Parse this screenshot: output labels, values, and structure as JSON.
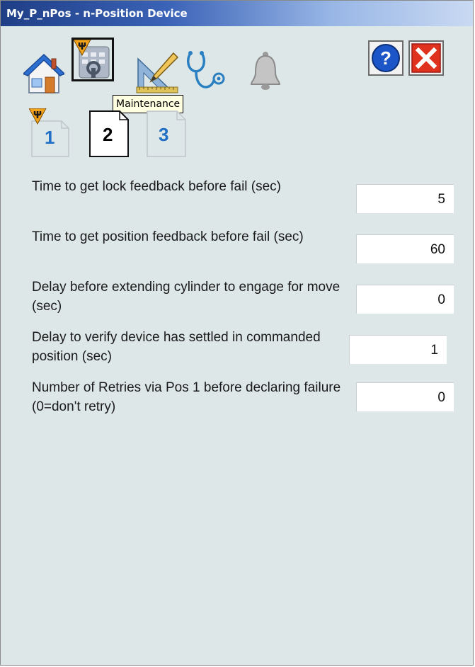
{
  "window": {
    "title": "My_P_nPos - n-Position Device"
  },
  "toolbar": {
    "buttons": [
      {
        "id": "home",
        "icon": "home-icon"
      },
      {
        "id": "maintenance",
        "icon": "maintenance-icon",
        "selected": true
      },
      {
        "id": "engineering",
        "icon": "engineering-icon"
      },
      {
        "id": "diagnostics",
        "icon": "stethoscope-icon"
      },
      {
        "id": "alarms",
        "icon": "bell-icon"
      },
      {
        "id": "help",
        "icon": "help-icon"
      },
      {
        "id": "close",
        "icon": "close-icon"
      }
    ],
    "tooltip": "Maintenance"
  },
  "tabs": [
    {
      "label": "1",
      "selected": false,
      "has_maint_icon": true
    },
    {
      "label": "2",
      "selected": true
    },
    {
      "label": "3",
      "selected": false
    }
  ],
  "parameters": [
    {
      "label": "Time to get lock feedback before fail (sec)",
      "value": "5"
    },
    {
      "label": "Time to get position feedback before fail (sec)",
      "value": "60"
    },
    {
      "label": "Delay before extending cylinder to engage for move (sec)",
      "value": "0"
    },
    {
      "label": "Delay to verify device has settled in commanded position (sec)",
      "value": "1"
    },
    {
      "label": "Number of Retries via Pos 1 before declaring failure (0=don't retry)",
      "value": "0"
    }
  ],
  "colors": {
    "panel_bg": "#dde7e8",
    "title_start": "#1f3e86",
    "title_end": "#c9d9f2",
    "tab_number_blue": "#1f6fc6",
    "close_red": "#e0301e",
    "help_blue": "#1b55c8"
  }
}
